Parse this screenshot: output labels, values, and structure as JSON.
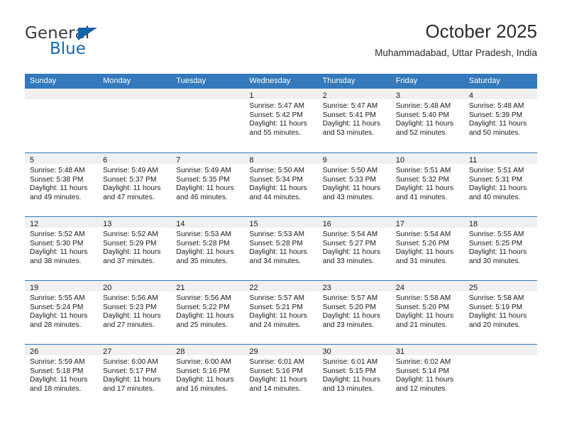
{
  "logo": {
    "word_one": "General",
    "word_two": "Blue",
    "triangle_icon": "blue-triangle-icon",
    "accent_color": "#1569b0"
  },
  "header": {
    "title": "October 2025",
    "subtitle": "Muhammadabad, Uttar Pradesh, India"
  },
  "calendar": {
    "header_bg": "#3479bb",
    "day_band_bg": "#f0f0f0",
    "weekdays": [
      "Sunday",
      "Monday",
      "Tuesday",
      "Wednesday",
      "Thursday",
      "Friday",
      "Saturday"
    ],
    "weeks": [
      [
        {
          "date": "",
          "lines": []
        },
        {
          "date": "",
          "lines": []
        },
        {
          "date": "",
          "lines": []
        },
        {
          "date": "1",
          "lines": [
            "Sunrise: 5:47 AM",
            "Sunset: 5:42 PM",
            "Daylight: 11 hours",
            "and 55 minutes."
          ]
        },
        {
          "date": "2",
          "lines": [
            "Sunrise: 5:47 AM",
            "Sunset: 5:41 PM",
            "Daylight: 11 hours",
            "and 53 minutes."
          ]
        },
        {
          "date": "3",
          "lines": [
            "Sunrise: 5:48 AM",
            "Sunset: 5:40 PM",
            "Daylight: 11 hours",
            "and 52 minutes."
          ]
        },
        {
          "date": "4",
          "lines": [
            "Sunrise: 5:48 AM",
            "Sunset: 5:39 PM",
            "Daylight: 11 hours",
            "and 50 minutes."
          ]
        }
      ],
      [
        {
          "date": "5",
          "lines": [
            "Sunrise: 5:48 AM",
            "Sunset: 5:38 PM",
            "Daylight: 11 hours",
            "and 49 minutes."
          ]
        },
        {
          "date": "6",
          "lines": [
            "Sunrise: 5:49 AM",
            "Sunset: 5:37 PM",
            "Daylight: 11 hours",
            "and 47 minutes."
          ]
        },
        {
          "date": "7",
          "lines": [
            "Sunrise: 5:49 AM",
            "Sunset: 5:35 PM",
            "Daylight: 11 hours",
            "and 46 minutes."
          ]
        },
        {
          "date": "8",
          "lines": [
            "Sunrise: 5:50 AM",
            "Sunset: 5:34 PM",
            "Daylight: 11 hours",
            "and 44 minutes."
          ]
        },
        {
          "date": "9",
          "lines": [
            "Sunrise: 5:50 AM",
            "Sunset: 5:33 PM",
            "Daylight: 11 hours",
            "and 43 minutes."
          ]
        },
        {
          "date": "10",
          "lines": [
            "Sunrise: 5:51 AM",
            "Sunset: 5:32 PM",
            "Daylight: 11 hours",
            "and 41 minutes."
          ]
        },
        {
          "date": "11",
          "lines": [
            "Sunrise: 5:51 AM",
            "Sunset: 5:31 PM",
            "Daylight: 11 hours",
            "and 40 minutes."
          ]
        }
      ],
      [
        {
          "date": "12",
          "lines": [
            "Sunrise: 5:52 AM",
            "Sunset: 5:30 PM",
            "Daylight: 11 hours",
            "and 38 minutes."
          ]
        },
        {
          "date": "13",
          "lines": [
            "Sunrise: 5:52 AM",
            "Sunset: 5:29 PM",
            "Daylight: 11 hours",
            "and 37 minutes."
          ]
        },
        {
          "date": "14",
          "lines": [
            "Sunrise: 5:53 AM",
            "Sunset: 5:28 PM",
            "Daylight: 11 hours",
            "and 35 minutes."
          ]
        },
        {
          "date": "15",
          "lines": [
            "Sunrise: 5:53 AM",
            "Sunset: 5:28 PM",
            "Daylight: 11 hours",
            "and 34 minutes."
          ]
        },
        {
          "date": "16",
          "lines": [
            "Sunrise: 5:54 AM",
            "Sunset: 5:27 PM",
            "Daylight: 11 hours",
            "and 33 minutes."
          ]
        },
        {
          "date": "17",
          "lines": [
            "Sunrise: 5:54 AM",
            "Sunset: 5:26 PM",
            "Daylight: 11 hours",
            "and 31 minutes."
          ]
        },
        {
          "date": "18",
          "lines": [
            "Sunrise: 5:55 AM",
            "Sunset: 5:25 PM",
            "Daylight: 11 hours",
            "and 30 minutes."
          ]
        }
      ],
      [
        {
          "date": "19",
          "lines": [
            "Sunrise: 5:55 AM",
            "Sunset: 5:24 PM",
            "Daylight: 11 hours",
            "and 28 minutes."
          ]
        },
        {
          "date": "20",
          "lines": [
            "Sunrise: 5:56 AM",
            "Sunset: 5:23 PM",
            "Daylight: 11 hours",
            "and 27 minutes."
          ]
        },
        {
          "date": "21",
          "lines": [
            "Sunrise: 5:56 AM",
            "Sunset: 5:22 PM",
            "Daylight: 11 hours",
            "and 25 minutes."
          ]
        },
        {
          "date": "22",
          "lines": [
            "Sunrise: 5:57 AM",
            "Sunset: 5:21 PM",
            "Daylight: 11 hours",
            "and 24 minutes."
          ]
        },
        {
          "date": "23",
          "lines": [
            "Sunrise: 5:57 AM",
            "Sunset: 5:20 PM",
            "Daylight: 11 hours",
            "and 23 minutes."
          ]
        },
        {
          "date": "24",
          "lines": [
            "Sunrise: 5:58 AM",
            "Sunset: 5:20 PM",
            "Daylight: 11 hours",
            "and 21 minutes."
          ]
        },
        {
          "date": "25",
          "lines": [
            "Sunrise: 5:58 AM",
            "Sunset: 5:19 PM",
            "Daylight: 11 hours",
            "and 20 minutes."
          ]
        }
      ],
      [
        {
          "date": "26",
          "lines": [
            "Sunrise: 5:59 AM",
            "Sunset: 5:18 PM",
            "Daylight: 11 hours",
            "and 18 minutes."
          ]
        },
        {
          "date": "27",
          "lines": [
            "Sunrise: 6:00 AM",
            "Sunset: 5:17 PM",
            "Daylight: 11 hours",
            "and 17 minutes."
          ]
        },
        {
          "date": "28",
          "lines": [
            "Sunrise: 6:00 AM",
            "Sunset: 5:16 PM",
            "Daylight: 11 hours",
            "and 16 minutes."
          ]
        },
        {
          "date": "29",
          "lines": [
            "Sunrise: 6:01 AM",
            "Sunset: 5:16 PM",
            "Daylight: 11 hours",
            "and 14 minutes."
          ]
        },
        {
          "date": "30",
          "lines": [
            "Sunrise: 6:01 AM",
            "Sunset: 5:15 PM",
            "Daylight: 11 hours",
            "and 13 minutes."
          ]
        },
        {
          "date": "31",
          "lines": [
            "Sunrise: 6:02 AM",
            "Sunset: 5:14 PM",
            "Daylight: 11 hours",
            "and 12 minutes."
          ]
        },
        {
          "date": "",
          "lines": []
        }
      ]
    ]
  }
}
